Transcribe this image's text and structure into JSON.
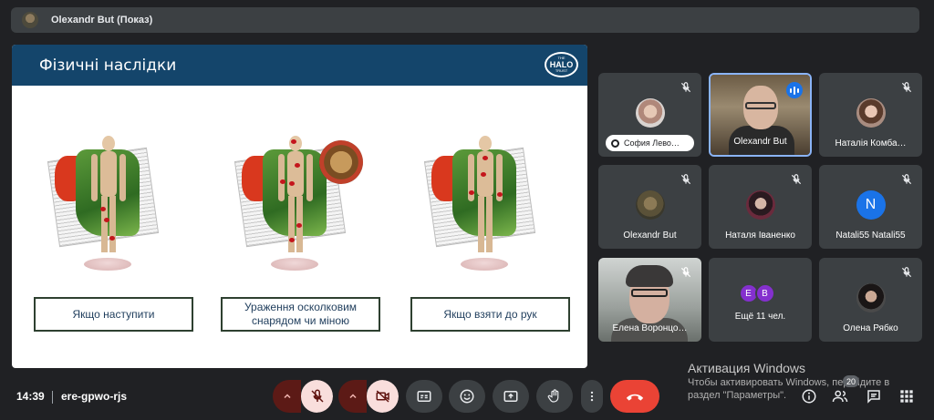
{
  "presenter_bar": {
    "title": "Olexandr But (Показ)"
  },
  "slide": {
    "title": "Фізичні наслідки",
    "logo_small": "THE",
    "logo_text": "HALO",
    "logo_sub": "TRUST",
    "captions": [
      "Якщо наступити",
      "Ураження осколковим снарядом чи міною",
      "Якщо взяти до рук"
    ]
  },
  "participants": [
    {
      "name": "София Лево…",
      "mic": "off"
    },
    {
      "name": "Olexandr But",
      "mic": "speaking"
    },
    {
      "name": "Наталія Комба…",
      "mic": "off"
    },
    {
      "name": "Olexandr But",
      "mic": "off"
    },
    {
      "name": "Наталя Іваненко",
      "mic": "off"
    },
    {
      "name": "Natali55 Natali55",
      "mic": "off",
      "initial": "N"
    },
    {
      "name": "Елена Воронцо…",
      "mic": "off"
    },
    {
      "name": "Ещё 11 чел.",
      "initials": [
        "E",
        "B"
      ]
    },
    {
      "name": "Олена Рябко",
      "mic": "off"
    }
  ],
  "bottom_bar": {
    "time": "14:39",
    "meeting_code": "ere-gpwo-rjs",
    "participant_count": "20"
  },
  "windows_watermark": {
    "title": "Активация Windows",
    "line1": "Чтобы активировать Windows, перейдите в",
    "line2": "раздел \"Параметры\"."
  },
  "colors": {
    "background": "#202124",
    "tile": "#3c4043",
    "slide_header": "#14456b",
    "end_call": "#ea4335",
    "muted_control": "#f9dedc"
  }
}
